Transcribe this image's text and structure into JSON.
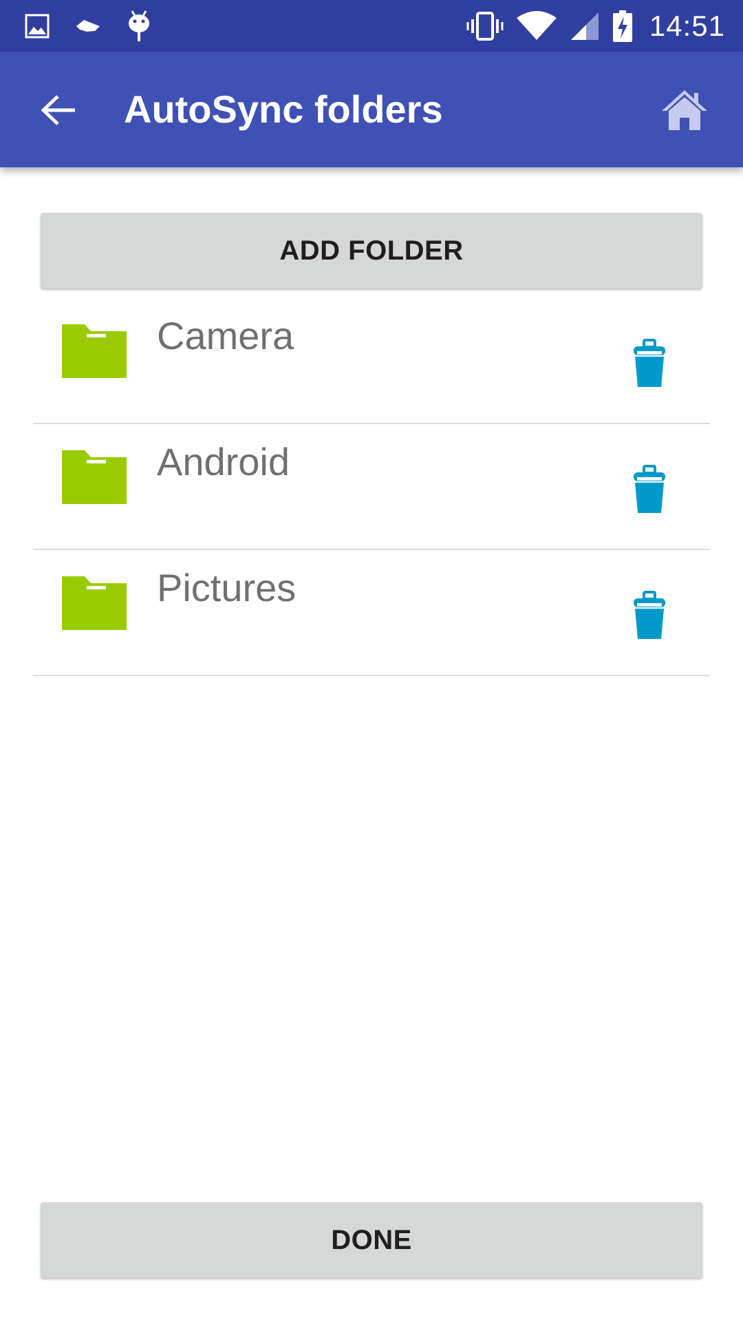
{
  "status_bar": {
    "time": "14:51",
    "left_icons": [
      "image-notification-icon",
      "cloud-notification-icon",
      "android-debug-icon"
    ],
    "right_icons": [
      "vibrate-icon",
      "wifi-icon",
      "cell-signal-icon",
      "battery-charging-icon"
    ],
    "background": "#303f9f"
  },
  "app_bar": {
    "title": "AutoSync folders",
    "back_icon": "arrow-back-icon",
    "home_icon": "home-icon",
    "background": "#3f51b5"
  },
  "add_button": {
    "label": "ADD FOLDER"
  },
  "folders": [
    {
      "name": "Camera"
    },
    {
      "name": "Android"
    },
    {
      "name": "Pictures"
    }
  ],
  "done_button": {
    "label": "DONE"
  },
  "colors": {
    "folder_icon": "#99cc00",
    "trash_icon": "#0099cc",
    "button_bg": "#d6d7d7",
    "folder_text": "#707070"
  }
}
